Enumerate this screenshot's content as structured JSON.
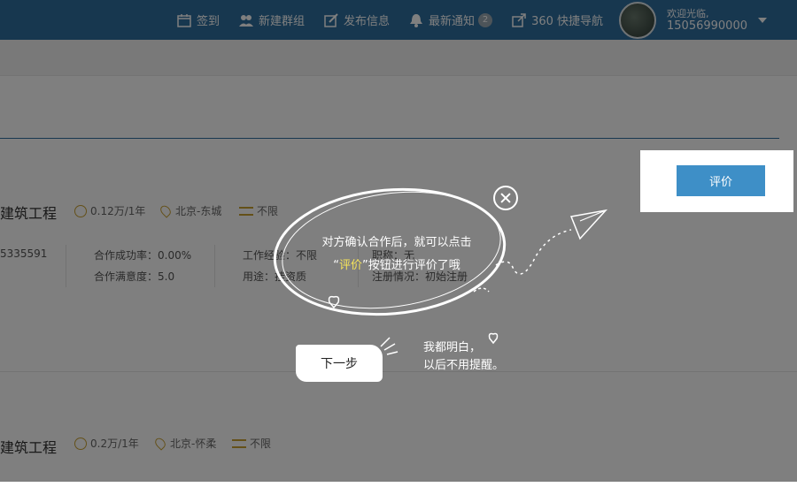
{
  "header": {
    "nav": [
      {
        "label": "签到",
        "icon": "calendar-icon"
      },
      {
        "label": "新建群组",
        "icon": "users-icon"
      },
      {
        "label": "发布信息",
        "icon": "edit-icon"
      },
      {
        "label": "最新通知",
        "icon": "bell-icon",
        "badge": "2"
      },
      {
        "label": "360 快捷导航",
        "icon": "external-link-icon"
      }
    ],
    "user": {
      "greeting": "欢迎光临,",
      "phone": "15056990000"
    }
  },
  "listings": [
    {
      "title": "建筑工程",
      "salary": "0.12万/1年",
      "location": "北京-东城",
      "education": "不限",
      "id_fragment": "5335591",
      "success_rate": "合作成功率：0.00%",
      "satisfaction": "合作满意度：5.0",
      "experience": "工作经验：不限",
      "usage": "用途：挂资质",
      "title_rank": "职称：无",
      "reg_status": "注册情况：初始注册"
    },
    {
      "title": "建筑工程",
      "salary": "0.2万/1年",
      "location": "北京-怀柔",
      "education": "不限"
    }
  ],
  "guide": {
    "line1": "对方确认合作后，就可以点击",
    "quote_open": "“",
    "highlight": "评价",
    "quote_close": "”",
    "line2_rest": "按钮进行评价了哦",
    "next_label": "下一步",
    "dismiss_line1": "我都明白，",
    "dismiss_line2": "以后不用提醒。"
  },
  "rate_button": {
    "label": "评价"
  },
  "colors": {
    "header": "#2f6f9f",
    "button": "#3e8fc7",
    "highlight": "#f5e35a"
  }
}
